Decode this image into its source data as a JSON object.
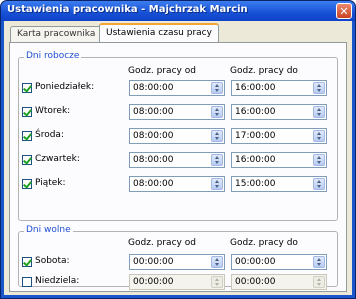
{
  "window": {
    "title": "Ustawienia pracownika - Majchrzak Marcin"
  },
  "tabs": [
    {
      "label": "Karta pracownika"
    },
    {
      "label": "Ustawienia czasu pracy"
    }
  ],
  "workdays": {
    "group_label": "Dni robocze",
    "col_from": "Godz. pracy od",
    "col_to": "Godz. pracy do",
    "rows": [
      {
        "label": "Poniedziałek:",
        "checked": true,
        "from": "08:00:00",
        "to": "16:00:00"
      },
      {
        "label": "Wtorek:",
        "checked": true,
        "from": "08:00:00",
        "to": "16:00:00"
      },
      {
        "label": "Środa:",
        "checked": true,
        "from": "08:00:00",
        "to": "17:00:00"
      },
      {
        "label": "Czwartek:",
        "checked": true,
        "from": "08:00:00",
        "to": "16:00:00"
      },
      {
        "label": "Piątek:",
        "checked": true,
        "from": "08:00:00",
        "to": "15:00:00"
      }
    ]
  },
  "weekend": {
    "group_label": "Dni wolne",
    "col_from": "Godz. pracy od",
    "col_to": "Godz. pracy do",
    "rows": [
      {
        "label": "Sobota:",
        "checked": true,
        "from": "00:00:00",
        "to": "00:00:00"
      },
      {
        "label": "Niedziela:",
        "checked": false,
        "from": "00:00:00",
        "to": "00:00:00"
      }
    ]
  },
  "colors": {
    "title_bar": "#1750d6",
    "close_button": "#c94324",
    "group_label": "#1f4fd1",
    "active_tab_accent": "#f3a533",
    "check_mark": "#21a121"
  }
}
